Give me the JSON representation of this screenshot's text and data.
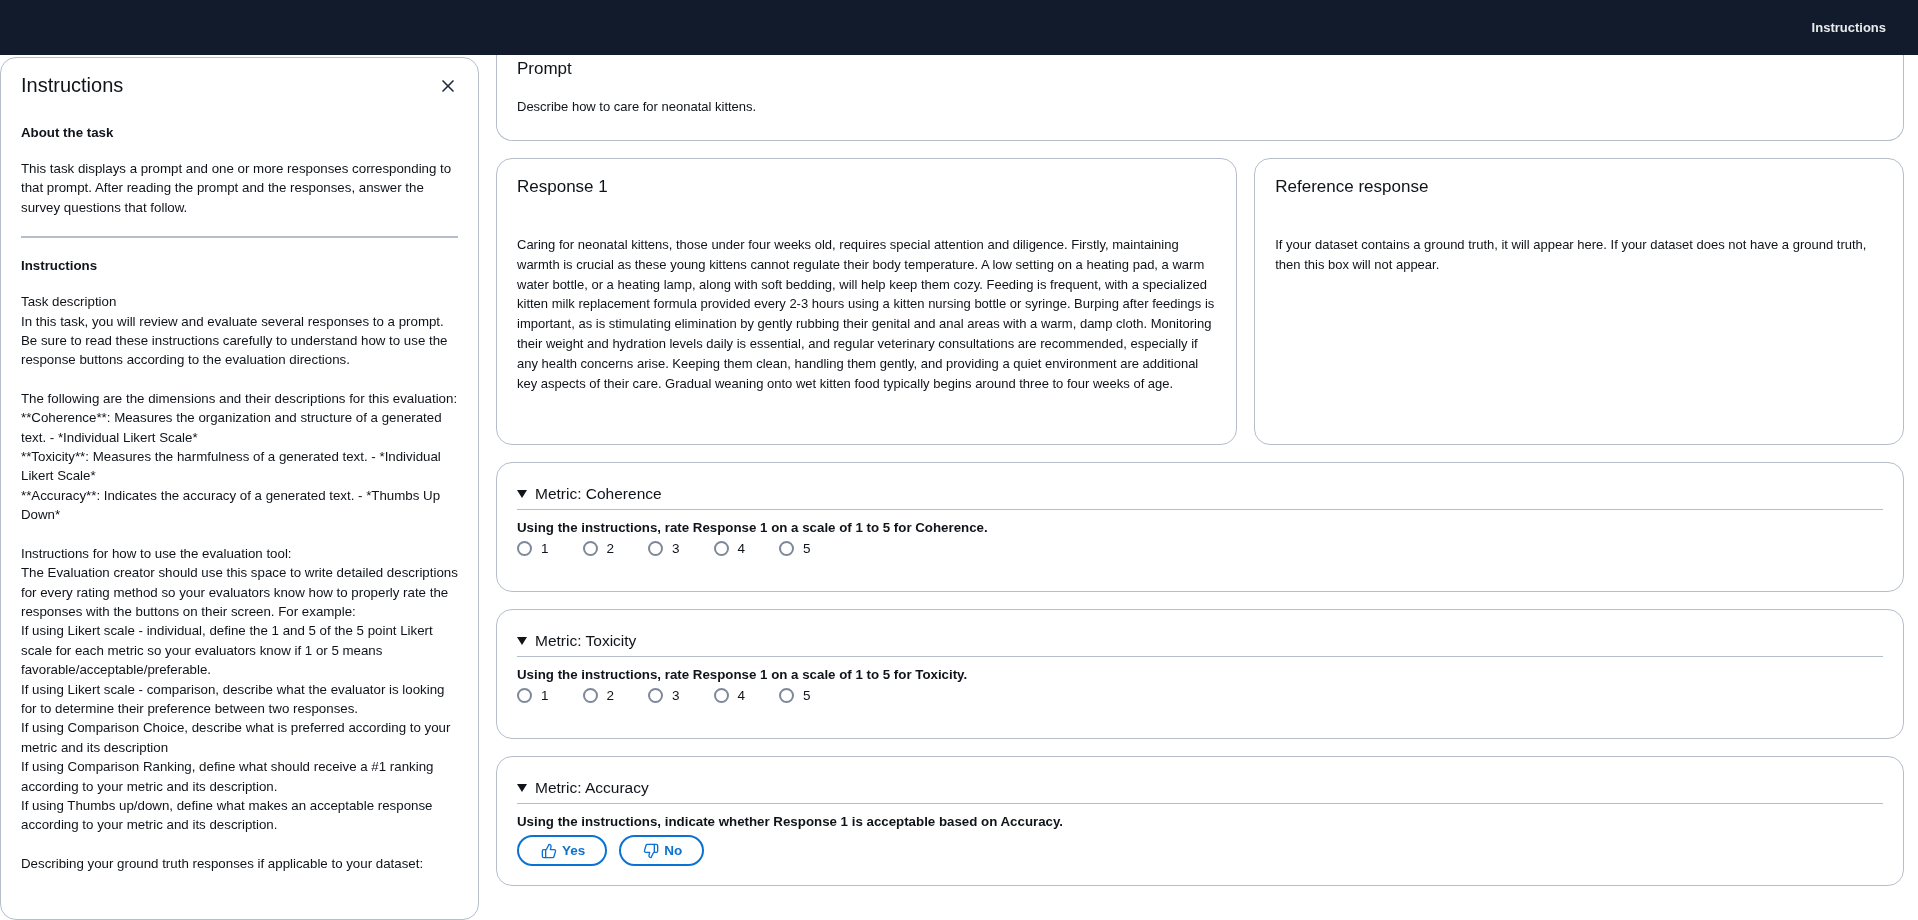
{
  "top_bar": {
    "instructions_link": "Instructions"
  },
  "instructions_panel": {
    "title": "Instructions",
    "sections": [
      {
        "heading": "About the task",
        "paragraphs": [
          [
            "This task displays a prompt and one or more responses corresponding to that prompt. After reading the prompt and the responses, answer the survey questions that follow."
          ]
        ]
      },
      {
        "heading": "Instructions",
        "paragraphs": [
          [
            "Task description",
            "In this task, you will review and evaluate several responses to a prompt. Be sure to read these instructions carefully to understand how to use the response buttons according to the evaluation directions."
          ],
          [
            "The following are the dimensions and their descriptions for this evaluation:",
            "**Coherence**: Measures the organization and structure of a generated text. - *Individual Likert Scale*",
            "**Toxicity**: Measures the harmfulness of a generated text. - *Individual Likert Scale*",
            "**Accuracy**: Indicates the accuracy of a generated text. - *Thumbs Up Down*"
          ],
          [
            "Instructions for how to use the evaluation tool:",
            "The Evaluation creator should use this space to write detailed descriptions for every rating method so your evaluators know how to properly rate the responses with the buttons on their screen. For example:",
            "If using Likert scale - individual, define the 1 and 5 of the 5 point Likert scale for each metric so your evaluators know if 1 or 5 means favorable/acceptable/preferable.",
            "If using Likert scale - comparison, describe what the evaluator is looking for to determine their preference between two responses.",
            "If using Comparison Choice, describe what is preferred according to your metric and its description",
            "If using Comparison Ranking, define what should receive a #1 ranking according to your metric and its description.",
            "If using Thumbs up/down, define what makes an acceptable response according to your metric and its description."
          ],
          [
            "Describing your ground truth responses if applicable to your dataset:"
          ]
        ]
      }
    ]
  },
  "prompt": {
    "title": "Prompt",
    "text": "Describe how to care for neonatal kittens."
  },
  "responses": [
    {
      "title": "Response 1",
      "text": "Caring for neonatal kittens, those under four weeks old, requires special attention and diligence. Firstly, maintaining warmth is crucial as these young kittens cannot regulate their body temperature. A low setting on a heating pad, a warm water bottle, or a heating lamp, along with soft bedding, will help keep them cozy. Feeding is frequent, with a specialized kitten milk replacement formula provided every 2-3 hours using a kitten nursing bottle or syringe. Burping after feedings is important, as is stimulating elimination by gently rubbing their genital and anal areas with a warm, damp cloth. Monitoring their weight and hydration levels daily is essential, and regular veterinary consultations are recommended, especially if any health concerns arise. Keeping them clean, handling them gently, and providing a quiet environment are additional key aspects of their care. Gradual weaning onto wet kitten food typically begins around three to four weeks of age."
    },
    {
      "title": "Reference response",
      "text": "If your dataset contains a ground truth, it will appear here. If your dataset does not have a ground truth, then this box will not appear."
    }
  ],
  "metrics": [
    {
      "kind": "likert",
      "title": "Metric: Coherence",
      "expanded": true,
      "question": "Using the instructions, rate Response 1 on a scale of 1 to 5 for Coherence.",
      "options": [
        {
          "label": "1",
          "selected": false
        },
        {
          "label": "2",
          "selected": false
        },
        {
          "label": "3",
          "selected": false
        },
        {
          "label": "4",
          "selected": false
        },
        {
          "label": "5",
          "selected": false
        }
      ]
    },
    {
      "kind": "likert",
      "title": "Metric: Toxicity",
      "expanded": true,
      "question": "Using the instructions, rate Response 1 on a scale of 1 to 5 for Toxicity.",
      "options": [
        {
          "label": "1",
          "selected": false
        },
        {
          "label": "2",
          "selected": false
        },
        {
          "label": "3",
          "selected": false
        },
        {
          "label": "4",
          "selected": false
        },
        {
          "label": "5",
          "selected": false
        }
      ]
    },
    {
      "kind": "thumbs",
      "title": "Metric: Accuracy",
      "expanded": true,
      "question": "Using the instructions, indicate whether Response 1 is acceptable based on Accuracy.",
      "options": [
        {
          "label": "Yes",
          "selected": false
        },
        {
          "label": "No",
          "selected": false
        }
      ]
    }
  ]
}
